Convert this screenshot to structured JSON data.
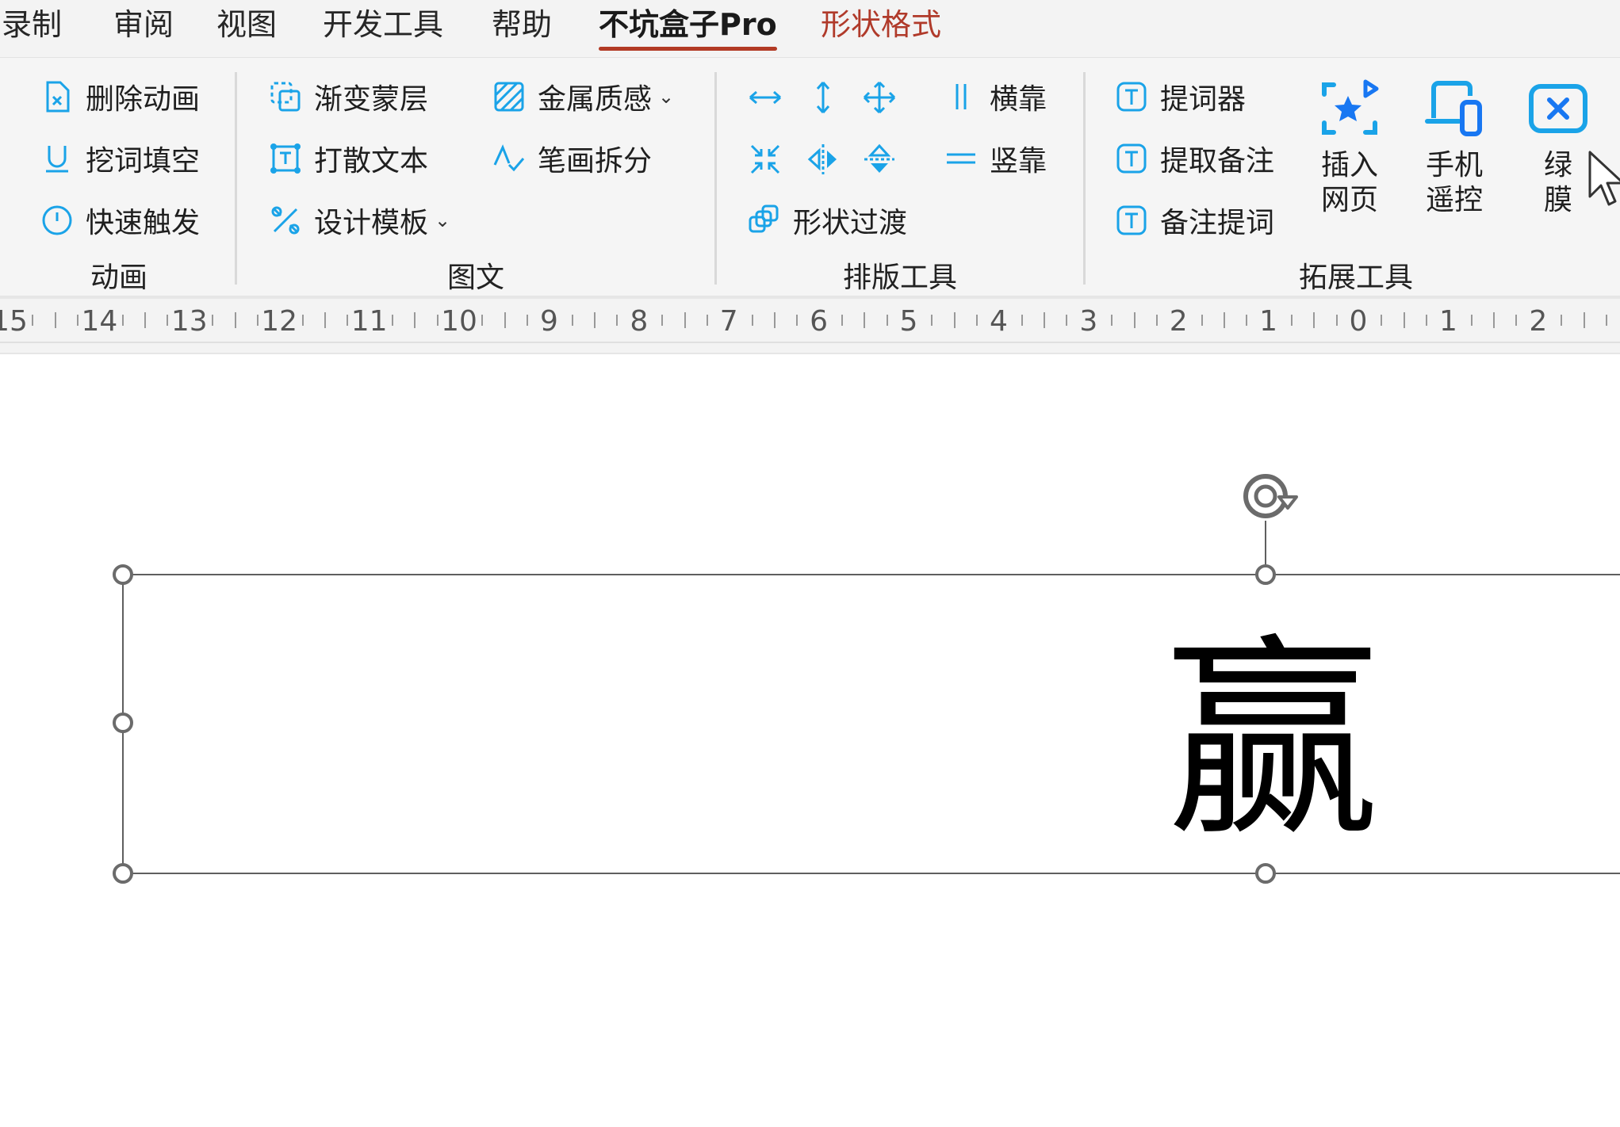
{
  "tabs": [
    {
      "label": "录制"
    },
    {
      "label": "审阅"
    },
    {
      "label": "视图"
    },
    {
      "label": "开发工具"
    },
    {
      "label": "帮助"
    },
    {
      "label": "不坑盒子Pro",
      "active": true
    },
    {
      "label": "形状格式",
      "contextual": true
    }
  ],
  "ribbon": {
    "groups": {
      "animation": {
        "label": "动画",
        "items": [
          "删除动画",
          "挖词填空",
          "快速触发"
        ]
      },
      "graphics_text": {
        "label": "图文",
        "items": [
          "渐变蒙层",
          "打散文本",
          "设计模板",
          "金属质感",
          "笔画拆分"
        ]
      },
      "layout_tools": {
        "label": "排版工具",
        "items": [
          "横靠",
          "竖靠",
          "形状过渡"
        ]
      },
      "extension_tools": {
        "label": "拓展工具",
        "items": [
          "提词器",
          "提取备注",
          "备注提词"
        ],
        "big": [
          "插入\n网页",
          "手机\n遥控",
          "绿\n膜"
        ]
      }
    },
    "colors": {
      "icon_accent": "#1aa3e8",
      "icon_accent_dark": "#1877f2"
    }
  },
  "ruler": {
    "labels": [
      "15",
      "14",
      "13",
      "12",
      "11",
      "10",
      "9",
      "8",
      "7",
      "6",
      "5",
      "4",
      "3",
      "2",
      "1",
      "0",
      "1",
      "2"
    ]
  },
  "slide": {
    "text": "赢"
  }
}
